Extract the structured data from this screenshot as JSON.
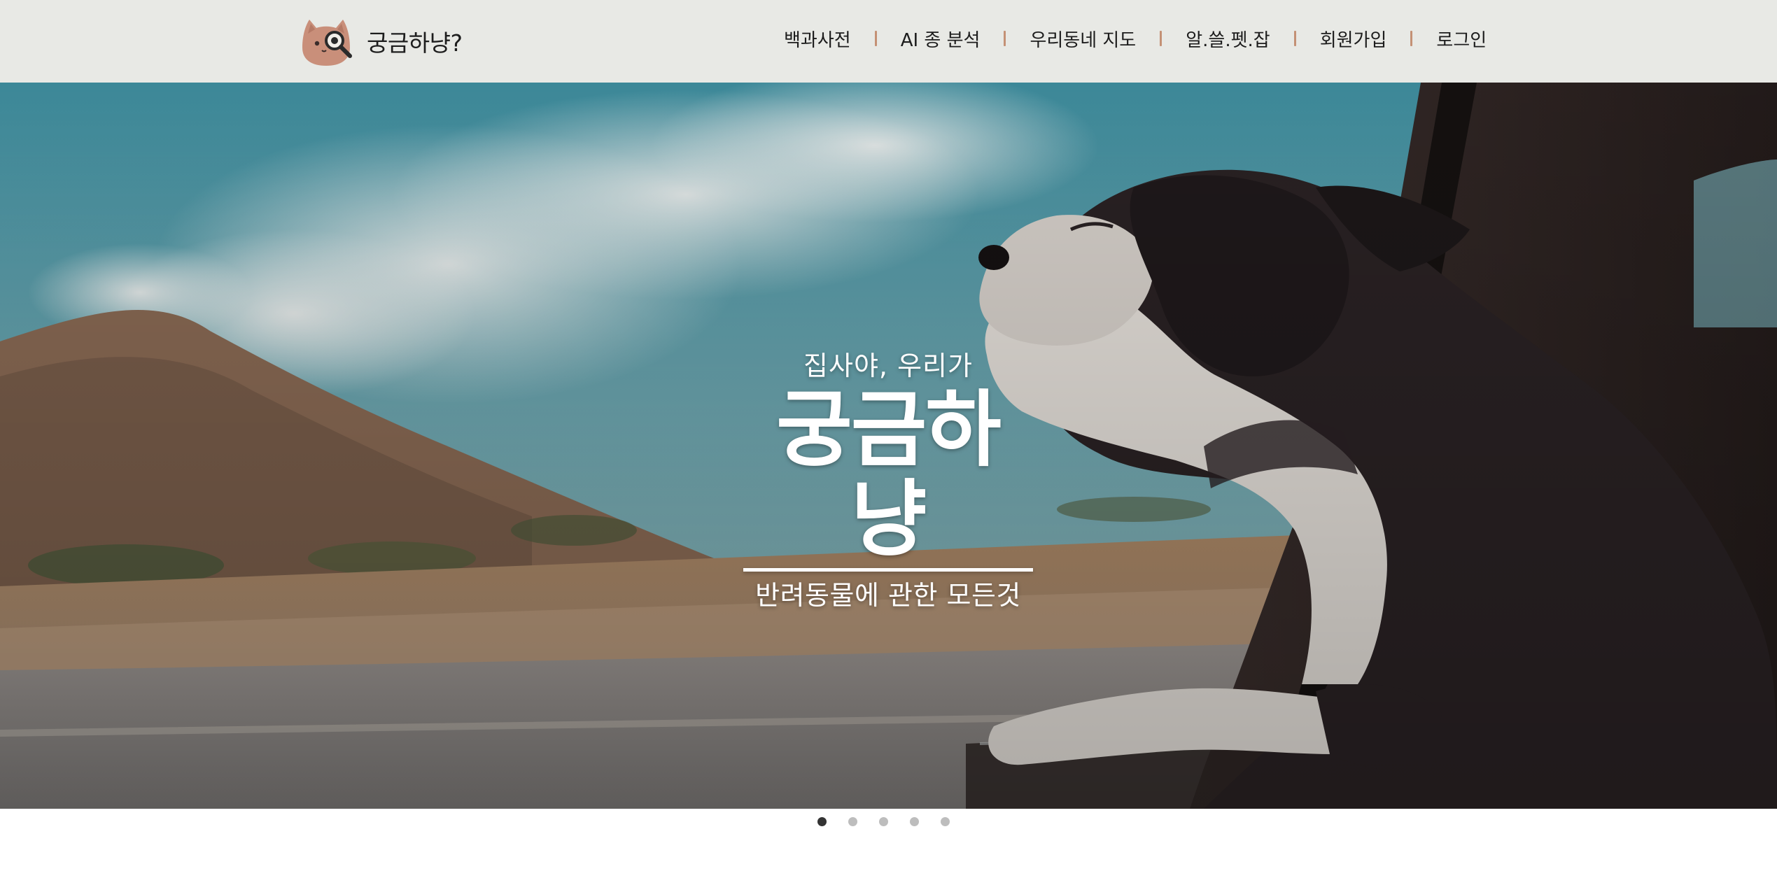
{
  "header": {
    "brand": "궁금하냥?",
    "nav": [
      {
        "label": "백과사전"
      },
      {
        "label": "AI 종 분석"
      },
      {
        "label": "우리동네 지도"
      },
      {
        "label": "알.쓸.펫.잡"
      },
      {
        "label": "회원가입"
      },
      {
        "label": "로그인"
      }
    ]
  },
  "hero": {
    "subtitle": "집사야, 우리가",
    "title": "궁금하냥",
    "caption": "반려동물에 관한 모든것"
  },
  "carousel": {
    "slides": 5,
    "active_index": 0
  },
  "colors": {
    "header_bg": "#e8e9e5",
    "nav_separator": "#c49175",
    "dot_active": "#333333",
    "dot_inactive": "#bdbdbd"
  },
  "icons": {
    "logo": "cat-with-magnifier-icon"
  }
}
